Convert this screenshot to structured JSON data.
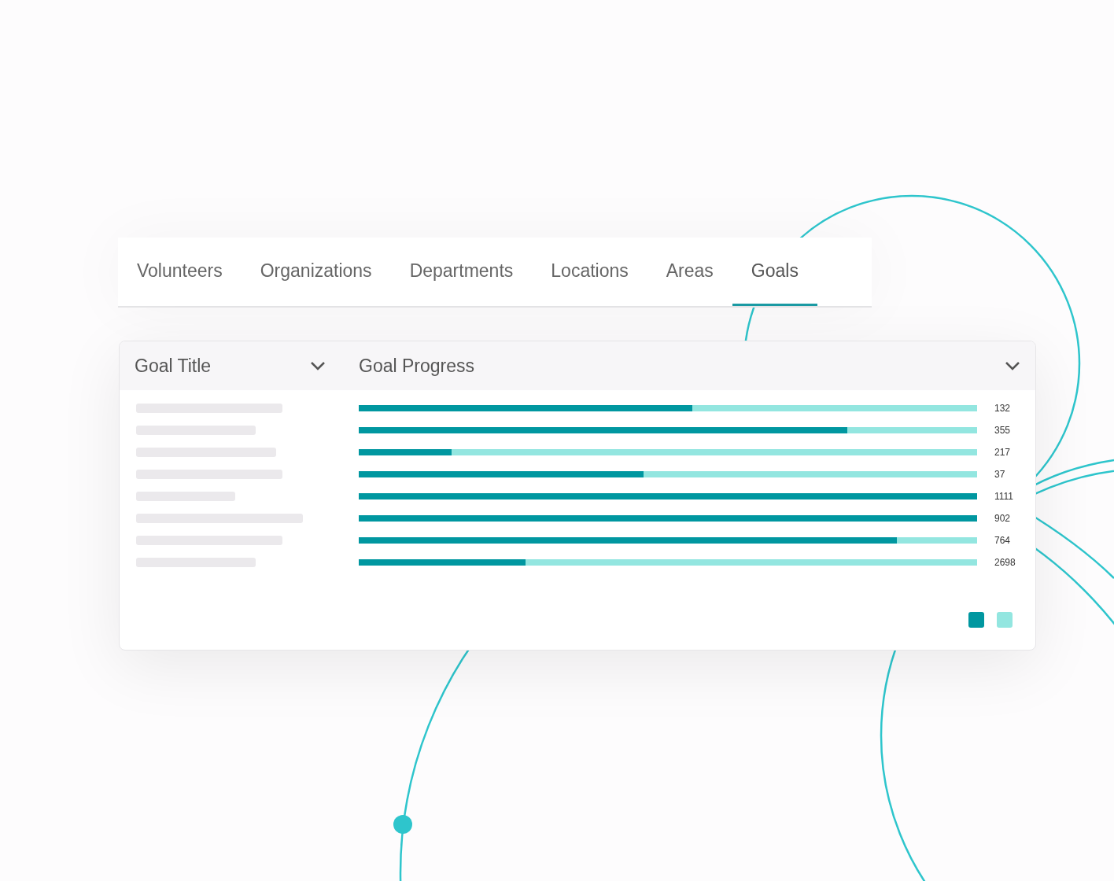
{
  "tabs": [
    {
      "label": "Volunteers",
      "selected": false
    },
    {
      "label": "Organizations",
      "selected": false
    },
    {
      "label": "Departments",
      "selected": false
    },
    {
      "label": "Locations",
      "selected": false
    },
    {
      "label": "Areas",
      "selected": false
    },
    {
      "label": "Goals",
      "selected": true
    }
  ],
  "table": {
    "columns": [
      {
        "label": "Goal Title"
      },
      {
        "label": "Goal Progress"
      }
    ],
    "rows": [
      {
        "level": 0.54,
        "count": "132"
      },
      {
        "level": 0.79,
        "count": "355"
      },
      {
        "level": 0.15,
        "count": "217"
      },
      {
        "level": 0.46,
        "count": "37"
      },
      {
        "level": 1.0,
        "count": "1111"
      },
      {
        "level": 1.0,
        "count": "902"
      },
      {
        "level": 0.87,
        "count": "764"
      },
      {
        "level": 0.27,
        "count": "2698"
      }
    ]
  },
  "legend": [
    {
      "color": "#0097a0"
    },
    {
      "color": "#93e6e0"
    }
  ]
}
